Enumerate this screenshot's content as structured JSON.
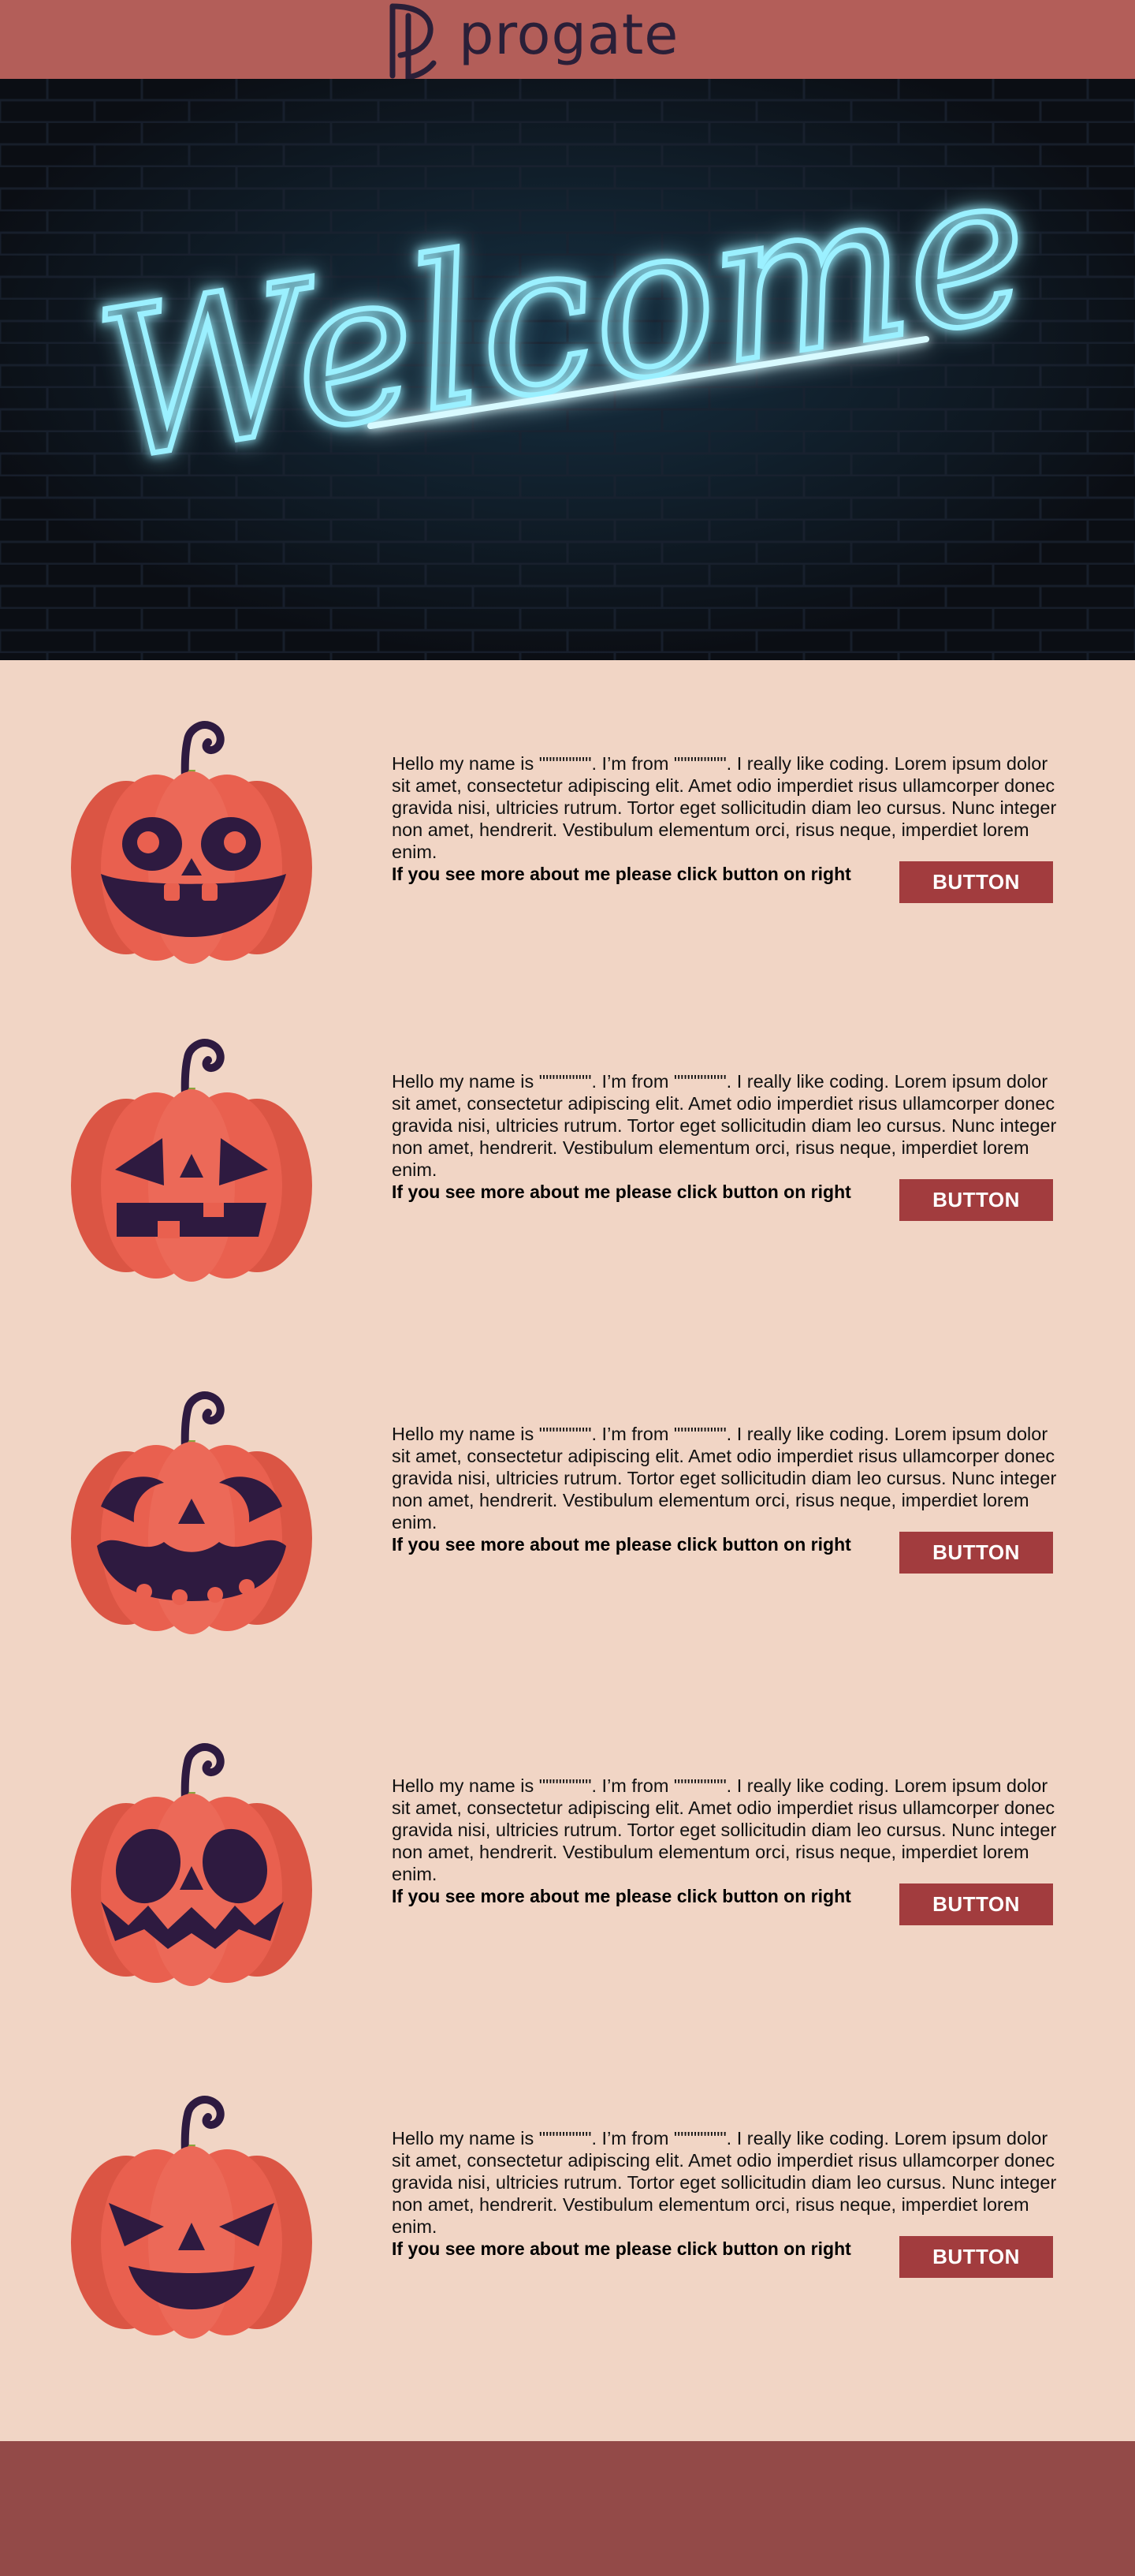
{
  "header": {
    "brand": "progate",
    "brand_color": "#2a1f38",
    "background": "#b35e59"
  },
  "hero": {
    "neon_text": "Welcome",
    "neon_color": "#7fe6ff",
    "background": "#0c0f15"
  },
  "profiles": [
    {
      "face": "round-eyes-big-smile",
      "description": "Hello my name is \"\"\"\"\"\"\"\". I’m from \"\"\"\"\"\"\"\". I really like coding. Lorem ipsum dolor sit amet, consectetur adipiscing elit. Amet odio imperdiet risus ullamcorper donec gravida nisi, ultricies rutrum. Tortor eget sollicitudin diam leo cursus. Nunc integer non amet, hendrerit. Vestibulum elementum orci, risus neque, imperdiet lorem enim.",
      "cta": "If you see more about me please click button on right",
      "button": "BUTTON"
    },
    {
      "face": "classic-triangle-eyes",
      "description": "Hello my name is \"\"\"\"\"\"\"\". I’m from \"\"\"\"\"\"\"\". I really like coding. Lorem ipsum dolor sit amet, consectetur adipiscing elit. Amet odio imperdiet risus ullamcorper donec gravida nisi, ultricies rutrum. Tortor eget sollicitudin diam leo cursus. Nunc integer non amet, hendrerit. Vestibulum elementum orci, risus neque, imperdiet lorem enim.",
      "cta": "If you see more about me please click button on right",
      "button": "BUTTON"
    },
    {
      "face": "scary-grin",
      "description": "Hello my name is \"\"\"\"\"\"\"\". I’m from \"\"\"\"\"\"\"\". I really like coding. Lorem ipsum dolor sit amet, consectetur adipiscing elit. Amet odio imperdiet risus ullamcorper donec gravida nisi, ultricies rutrum. Tortor eget sollicitudin diam leo cursus. Nunc integer non amet, hendrerit. Vestibulum elementum orci, risus neque, imperdiet lorem enim.",
      "cta": "If you see more about me please click button on right",
      "button": "BUTTON"
    },
    {
      "face": "oval-eyes-zigzag",
      "description": "Hello my name is \"\"\"\"\"\"\"\". I’m from \"\"\"\"\"\"\"\". I really like coding. Lorem ipsum dolor sit amet, consectetur adipiscing elit. Amet odio imperdiet risus ullamcorper donec gravida nisi, ultricies rutrum. Tortor eget sollicitudin diam leo cursus. Nunc integer non amet, hendrerit. Vestibulum elementum orci, risus neque, imperdiet lorem enim.",
      "cta": "If you see more about me please click button on right",
      "button": "BUTTON"
    },
    {
      "face": "angry-triangle-eyes",
      "description": "Hello my name is \"\"\"\"\"\"\"\". I’m from \"\"\"\"\"\"\"\". I really like coding. Lorem ipsum dolor sit amet, consectetur adipiscing elit. Amet odio imperdiet risus ullamcorper donec gravida nisi, ultricies rutrum. Tortor eget sollicitudin diam leo cursus. Nunc integer non amet, hendrerit. Vestibulum elementum orci, risus neque, imperdiet lorem enim.",
      "cta": "If you see more about me please click button on right",
      "button": "BUTTON"
    }
  ],
  "colors": {
    "page_background": "#f1d5c5",
    "pumpkin": "#e9604f",
    "pumpkin_face": "#2e1a40",
    "button": "#a23c3e",
    "footer": "#934a48"
  }
}
